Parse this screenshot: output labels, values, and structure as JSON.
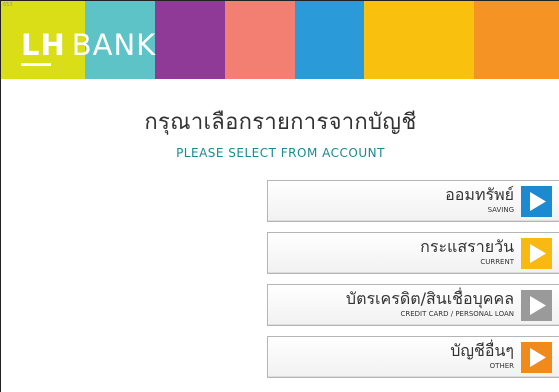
{
  "screen_id": "653",
  "brand": {
    "prefix": "LH",
    "name": "BANK"
  },
  "header_colors": [
    "#d9de16",
    "#5dc3c6",
    "#8f3a97",
    "#f27f71",
    "#2a9ad8",
    "#f9c10e",
    "#f59424"
  ],
  "title_th": "กรุณาเลือกรายการจากบัญชี",
  "title_en": "PLEASE  SELECT  FROM  ACCOUNT",
  "menu": [
    {
      "th": "ออมทรัพย์",
      "en": "SAVING",
      "color": "#1c8ad1",
      "icon": "play-arrow-icon"
    },
    {
      "th": "กระแสรายวัน",
      "en": "CURRENT",
      "color": "#f7b912",
      "icon": "play-arrow-icon"
    },
    {
      "th": "บัตรเครดิต/สินเชื่อบุคคล",
      "en": "CREDIT CARD / PERSONAL LOAN",
      "color": "#9a9a9a",
      "icon": "play-arrow-icon"
    },
    {
      "th": "บัญชีอื่นๆ",
      "en": "OTHER",
      "color": "#f08a1c",
      "icon": "play-arrow-icon"
    }
  ]
}
